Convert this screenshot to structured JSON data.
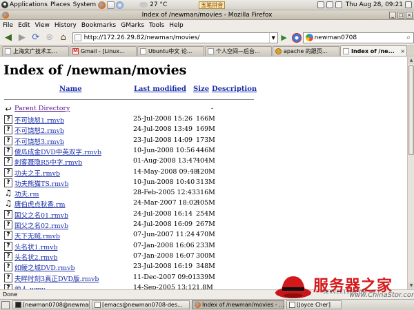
{
  "panel": {
    "applications": "Applications",
    "places": "Places",
    "system": "System",
    "weather": "27 °C",
    "ime": "五笔拼音",
    "clock": "Thu Aug 28, 09:21"
  },
  "window": {
    "title": "Index of /newman/movies - Mozilla Firefox"
  },
  "menu": [
    "File",
    "Edit",
    "View",
    "History",
    "Bookmarks",
    "GMarks",
    "Tools",
    "Help"
  ],
  "nav": {
    "url": "http://172.26.29.82/newman/movies/",
    "search": "newman0708"
  },
  "tabs": [
    {
      "label": "上海文广技术工..."
    },
    {
      "label": "Gmail - [Linux..."
    },
    {
      "label": "Ubuntu中文 论..."
    },
    {
      "label": "个人空间—后台..."
    },
    {
      "label": "apache 的跟页..."
    },
    {
      "label": "Index of /ne..."
    }
  ],
  "page": {
    "heading": "Index of /newman/movies",
    "col_name": "Name",
    "col_modified": "Last modified",
    "col_size": "Size",
    "col_description": "Description",
    "parent": {
      "name": "Parent Directory",
      "date": "",
      "size": "-"
    },
    "files": [
      {
        "icon": "unknown",
        "name": "不可饶恕1.rmvb",
        "date": "25-Jul-2008 15:26",
        "size": "166M"
      },
      {
        "icon": "unknown",
        "name": "不可饶恕2.rmvb",
        "date": "24-Jul-2008 13:49",
        "size": "169M"
      },
      {
        "icon": "unknown",
        "name": "不可饶恕3.rmvb",
        "date": "23-Jul-2008 14:09",
        "size": "173M"
      },
      {
        "icon": "unknown",
        "name": "傻瓜成金DVD中英双字.rmvb",
        "date": "10-Jun-2008 10:56",
        "size": "446M"
      },
      {
        "icon": "unknown",
        "name": "刺客聂隐R5中字.rmvb",
        "date": "01-Aug-2008 13:47",
        "size": "404M"
      },
      {
        "icon": "unknown",
        "name": "功夫之王.rmvb",
        "date": "14-May-2008 09:48",
        "size": "420M"
      },
      {
        "icon": "unknown",
        "name": "功夫熊猫TS.rmvb",
        "date": "10-Jun-2008 10:40",
        "size": "313M"
      },
      {
        "icon": "sound",
        "name": "功夫.rm",
        "date": "28-Feb-2005 12:43",
        "size": "316M"
      },
      {
        "icon": "sound",
        "name": "唐伯虎点秋香.rm",
        "date": "24-Mar-2007 18:02",
        "size": "405M"
      },
      {
        "icon": "unknown",
        "name": "国父之名01.rmvb",
        "date": "24-Jul-2008 16:14",
        "size": "254M"
      },
      {
        "icon": "unknown",
        "name": "国父之名02.rmvb",
        "date": "24-Jul-2008 16:09",
        "size": "267M"
      },
      {
        "icon": "unknown",
        "name": "天下无贼.rmvb",
        "date": "07-Jun-2007 11:24",
        "size": "470M"
      },
      {
        "icon": "unknown",
        "name": "头名状1.rmvb",
        "date": "07-Jan-2008 16:06",
        "size": "233M"
      },
      {
        "icon": "unknown",
        "name": "头名状2.rmvb",
        "date": "07-Jan-2008 16:07",
        "size": "300M"
      },
      {
        "icon": "unknown",
        "name": "如鲠之城DVD.rmvb",
        "date": "23-Jul-2008 16:19",
        "size": "348M"
      },
      {
        "icon": "unknown",
        "name": "夫畔时刻3真正DVD版.rmvb",
        "date": "11-Dec-2007 09:01",
        "size": "339M"
      },
      {
        "icon": "unknown",
        "name": "帅人.wmv",
        "date": "14-Sep-2005 13:12",
        "size": "1.8M"
      }
    ]
  },
  "status": "Done",
  "watermark": {
    "cn": "服务器之家",
    "en": "SERVER110.COM",
    "url": "www.ChinaStor.com"
  },
  "taskbar": [
    {
      "label": "[newman0708@newman0...",
      "icon": "term"
    },
    {
      "label": "[emacs@newman0708-des...",
      "icon": "doc"
    },
    {
      "label": "Index of /newman/movies - ...",
      "icon": "ff"
    },
    {
      "label": "[Joyce Cher]",
      "icon": "doc"
    }
  ],
  "colors": {
    "link": "#1b2fa8",
    "visited": "#551a8b",
    "watermark": "#d4191c"
  }
}
